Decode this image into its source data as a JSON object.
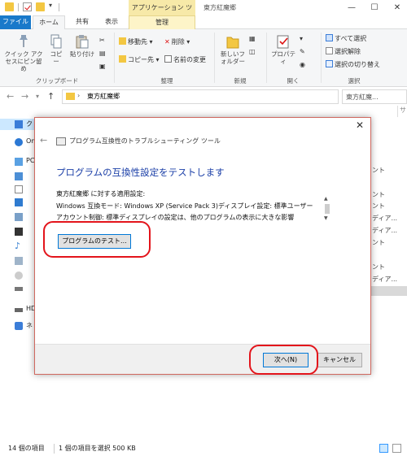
{
  "window": {
    "contextual_tab_title": "アプリケーション ツール",
    "title": "東方紅魔郷"
  },
  "ribbon_tabs": {
    "file": "ファイル",
    "home": "ホーム",
    "share": "共有",
    "view": "表示",
    "manage": "管理"
  },
  "ribbon": {
    "pin_quick_access": "クイック アクセスにピン留め",
    "copy": "コピー",
    "paste": "貼り付け",
    "move_to": "移動先 ▾",
    "copy_to": "コピー先 ▾",
    "delete": "削除 ▾",
    "rename": "名前の変更",
    "new_folder": "新しいフォルダー",
    "properties": "プロパティ",
    "select_all": "すべて選択",
    "select_none": "選択解除",
    "invert_selection": "選択の切り替え",
    "group_clipboard": "クリップボード",
    "group_organize": "整理",
    "group_new": "新規",
    "group_open": "開く",
    "group_select": "選択"
  },
  "address": {
    "path": "東方紅魔郷",
    "search_placeholder": "東方紅魔..."
  },
  "navpane": {
    "items": [
      "ク",
      "On",
      "PC",
      "",
      "",
      "",
      "",
      "",
      "",
      "",
      "",
      "HD",
      "ネ"
    ]
  },
  "file_list_edge": {
    "column_header": "サ",
    "rows": [
      "ント",
      "ント",
      "ント",
      "ディア...",
      "ディア...",
      "ント",
      "ント",
      "ディア..."
    ]
  },
  "status": {
    "item_count": "14 個の項目",
    "selected": "1 個の項目を選択  500 KB"
  },
  "dialog": {
    "app_title": "プログラム互換性のトラブルシューティング ツール",
    "heading": "プログラムの互換性設定をテストします",
    "settings_lines": [
      "東方紅魔郷 に対する適用設定:",
      "Windows 互換モード: Windows XP (Service Pack 3)ディスプレイ設定: 標準ユーザー",
      "アカウント制御: 標準ディスプレイの設定は、他のプログラムの表示に大きな影響"
    ],
    "test_button": "プログラムのテスト...",
    "next_button": "次へ(N)",
    "cancel_button": "キャンセル"
  },
  "colors": {
    "accent_blue": "#1979ca",
    "heading_blue": "#1a3ea7",
    "annotation_red": "#e3141b",
    "manage_tab": "#fdf4c8"
  }
}
